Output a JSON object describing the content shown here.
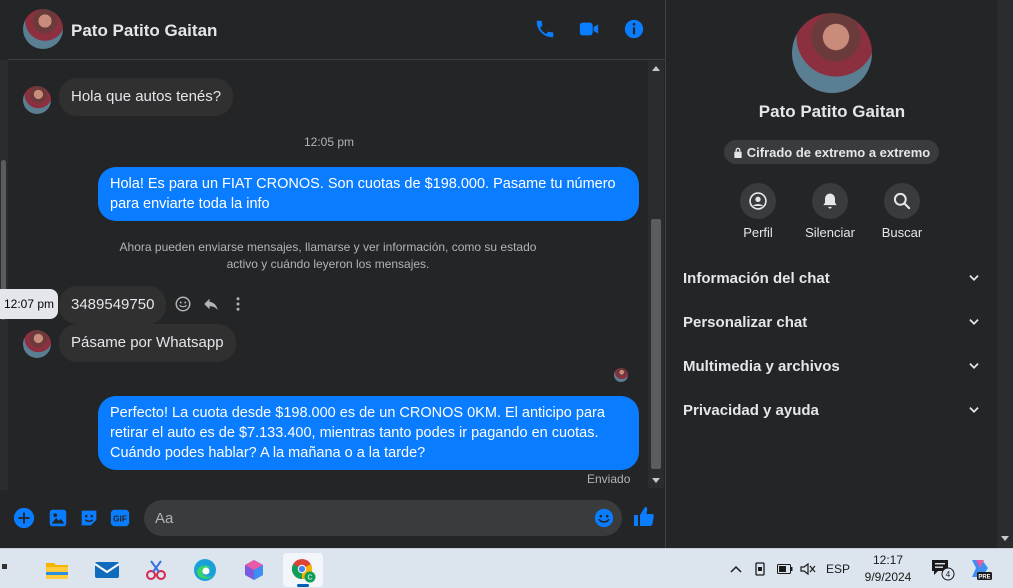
{
  "contact": {
    "name": "Pato Patito Gaitan"
  },
  "messages": {
    "incoming_1": "Hola que autos tenés?",
    "time_1": "12:05 pm",
    "outgoing_1": "Hola! Es para un FIAT CRONOS. Son cuotas de $198.000. Pasame tu número para enviarte toda la info",
    "system_notice": "Ahora pueden enviarse mensajes, llamarse y ver información, como su estado activo y cuándo leyeron los mensajes.",
    "incoming_2": "3489549750",
    "incoming_2_tooltip": "12:07 pm",
    "incoming_3": "Pásame por Whatsapp",
    "outgoing_2": "Perfecto! La cuota desde $198.000 es de un CRONOS 0KM. El anticipo para retirar el auto es de $7.133.400, mientras tanto podes ir pagando en cuotas. Cuándo podes hablar? A la mañana o a la tarde?",
    "status": "Enviado"
  },
  "composer": {
    "placeholder": "Aa"
  },
  "details": {
    "encryption_badge": "Cifrado de extremo a extremo",
    "actions": [
      {
        "label": "Perfil",
        "icon": "profile-icon"
      },
      {
        "label": "Silenciar",
        "icon": "bell-icon"
      },
      {
        "label": "Buscar",
        "icon": "search-icon"
      }
    ],
    "sections": [
      {
        "label": "Información del chat"
      },
      {
        "label": "Personalizar chat"
      },
      {
        "label": "Multimedia y archivos"
      },
      {
        "label": "Privacidad y ayuda"
      }
    ]
  },
  "taskbar": {
    "language": "ESP",
    "time": "12:17",
    "date": "9/9/2024",
    "notification_count": "4",
    "copilot_badge": "PRE",
    "chrome_profile_letter": "C"
  },
  "colors": {
    "accent": "#0a7cff",
    "background": "#242526",
    "bubble_in": "#303030"
  }
}
